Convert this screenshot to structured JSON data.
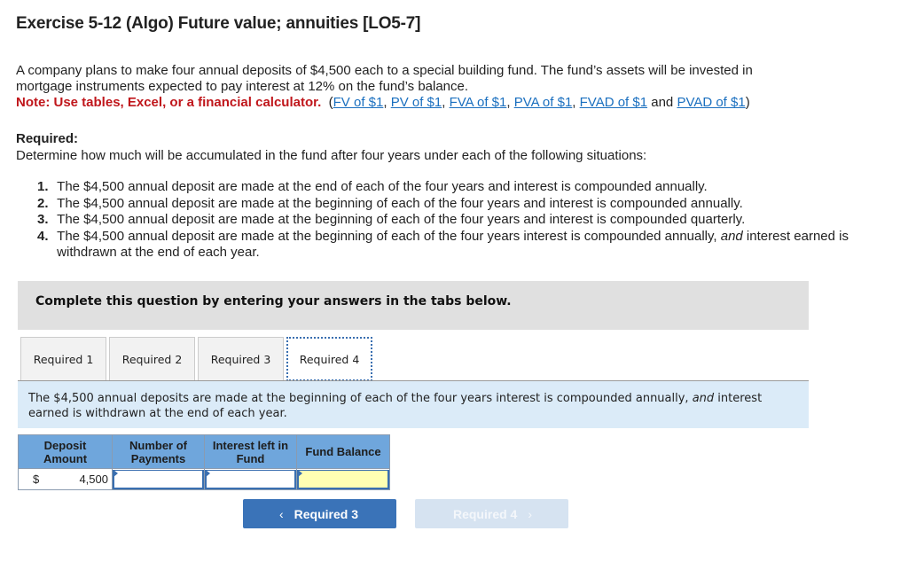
{
  "title": "Exercise 5-12 (Algo) Future value; annuities [LO5-7]",
  "intro": {
    "line1": "A company plans to make four annual deposits of $4,500 each to a special building fund. The fund’s assets will be invested in",
    "line2": "mortgage instruments expected to pay interest at 12% on the fund’s balance.",
    "note_bold": "Note: Use tables, Excel, or a financial calculator.",
    "links": [
      "FV of $1",
      "PV of $1",
      "FVA of $1",
      "PVA of $1",
      "FVAD of $1",
      "PVAD of $1"
    ],
    "and_word": "and"
  },
  "required": {
    "heading": "Required:",
    "description": "Determine how much will be accumulated in the fund after four years under each of the following situations:",
    "items": [
      {
        "num": "1.",
        "text": "The $4,500 annual deposit are made at the end of each of the four years  and interest is compounded annually."
      },
      {
        "num": "2.",
        "text": "The $4,500 annual deposit are made at the beginning of each of the four years and interest is compounded annually."
      },
      {
        "num": "3.",
        "text": "The $4,500 annual deposit are made at the beginning of each of the four years and interest is compounded quarterly."
      },
      {
        "num": "4.",
        "text_before": "The $4,500 annual deposit are made at the beginning of each of the four years interest is compounded annually, ",
        "text_italic": "and",
        "text_after": " interest earned is withdrawn at the end of each year."
      }
    ]
  },
  "panel_text": "Complete this question by entering your answers in the tabs below.",
  "tabs": [
    {
      "label": "Required 1",
      "active": false
    },
    {
      "label": "Required 2",
      "active": false
    },
    {
      "label": "Required 3",
      "active": false
    },
    {
      "label": "Required 4",
      "active": true
    }
  ],
  "info": {
    "before": "The $4,500 annual deposits are made at the beginning of each of the four years interest is compounded annually, ",
    "italic": "and",
    "after": " interest earned is withdrawn at the end of each year."
  },
  "table": {
    "headers": [
      "Deposit Amount",
      "Number of Payments",
      "Interest left in Fund",
      "Fund Balance"
    ],
    "row": {
      "currency": "$",
      "deposit": "4,500",
      "number_of_payments": "",
      "interest_left": "",
      "fund_balance": ""
    }
  },
  "nav": {
    "prev_label": "Required 3",
    "next_label": "Required 4",
    "prev_icon": "chevron-left-icon",
    "next_icon": "chevron-right-icon"
  }
}
